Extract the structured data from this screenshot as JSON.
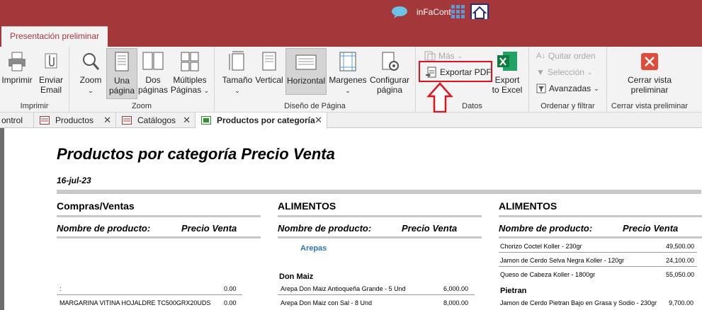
{
  "titlebar": {
    "title": "inFaCont"
  },
  "ribbon_tab": {
    "label": "Presentación preliminar"
  },
  "groups": {
    "imprimir": {
      "label": "Imprimir",
      "print_label": "Imprimir",
      "email_label_1": "Enviar",
      "email_label_2": "Email"
    },
    "zoom": {
      "label": "Zoom",
      "zoom_label": "Zoom",
      "one_page_1": "Una",
      "one_page_2": "página",
      "two_pages_1": "Dos",
      "two_pages_2": "páginas",
      "multi_1": "Múltiples",
      "multi_2": "Páginas"
    },
    "diseno": {
      "label": "Diseño de Página",
      "size_label": "Tamaño",
      "vertical_label": "Vertical",
      "horizontal_label": "Horizontal",
      "margins_label": "Margenes",
      "config_1": "Configurar",
      "config_2": "página"
    },
    "datos": {
      "label": "Datos",
      "more_label": "Más",
      "export_pdf_label": "Exportar PDF",
      "excel_1": "Export",
      "excel_2": "to Excel"
    },
    "ordenar": {
      "label": "Ordenar y filtrar",
      "remove_sort": "Quitar orden",
      "selection": "Selección",
      "advanced": "Avanzadas"
    },
    "cerrar": {
      "label": "Cerrar vista preliminar",
      "close_1": "Cerrar vista",
      "close_2": "preliminar"
    }
  },
  "doc_tabs": [
    {
      "label": "ontrol"
    },
    {
      "label": "Productos"
    },
    {
      "label": "Catálogos"
    },
    {
      "label": "Productos por categoría"
    }
  ],
  "report": {
    "title": "Productos por categoría Precio Venta",
    "date": "16-jul-23",
    "columns": [
      {
        "title": "Compras/Ventas",
        "hdr_name": "Nombre de producto:",
        "hdr_price": "Precio Venta",
        "rows": [
          {
            "name": ":",
            "price": "0.00"
          },
          {
            "name": "MARGARINA VITINA HOJALDRE TC500GRX20UDS",
            "price": "0.00"
          }
        ]
      },
      {
        "title": "ALIMENTOS",
        "hdr_name": "Nombre de producto:",
        "hdr_price": "Precio Venta",
        "sub_blue": "Arepas",
        "sub_group": "Don Maiz",
        "rows": [
          {
            "name": "Arepa Don Maiz Antioqueña Grande - 5 Und",
            "price": "6,000.00"
          },
          {
            "name": "Arepa Don Maiz con Sal - 8 Und",
            "price": "8,000.00"
          }
        ]
      },
      {
        "title": "ALIMENTOS",
        "hdr_name": "Nombre de producto:",
        "hdr_price": "Precio Venta",
        "sub_group": "Pietran",
        "rows": [
          {
            "name": "Chorizo Coctel Koller - 230gr",
            "price": "49,500.00"
          },
          {
            "name": "Jamon de Cerdo Selva Negra Koller - 120gr",
            "price": "24,100.00"
          },
          {
            "name": "Queso de Cabeza Koller - 1800gr",
            "price": "55,050.00"
          },
          {
            "name": "Jamon de Cerdo Pietran Bajo en Grasa y Sodio - 230gr",
            "price": "9,700.00"
          }
        ]
      }
    ]
  },
  "colors": {
    "accent": "#a4373a",
    "highlight": "#e4101a",
    "link": "#2e75b6"
  }
}
